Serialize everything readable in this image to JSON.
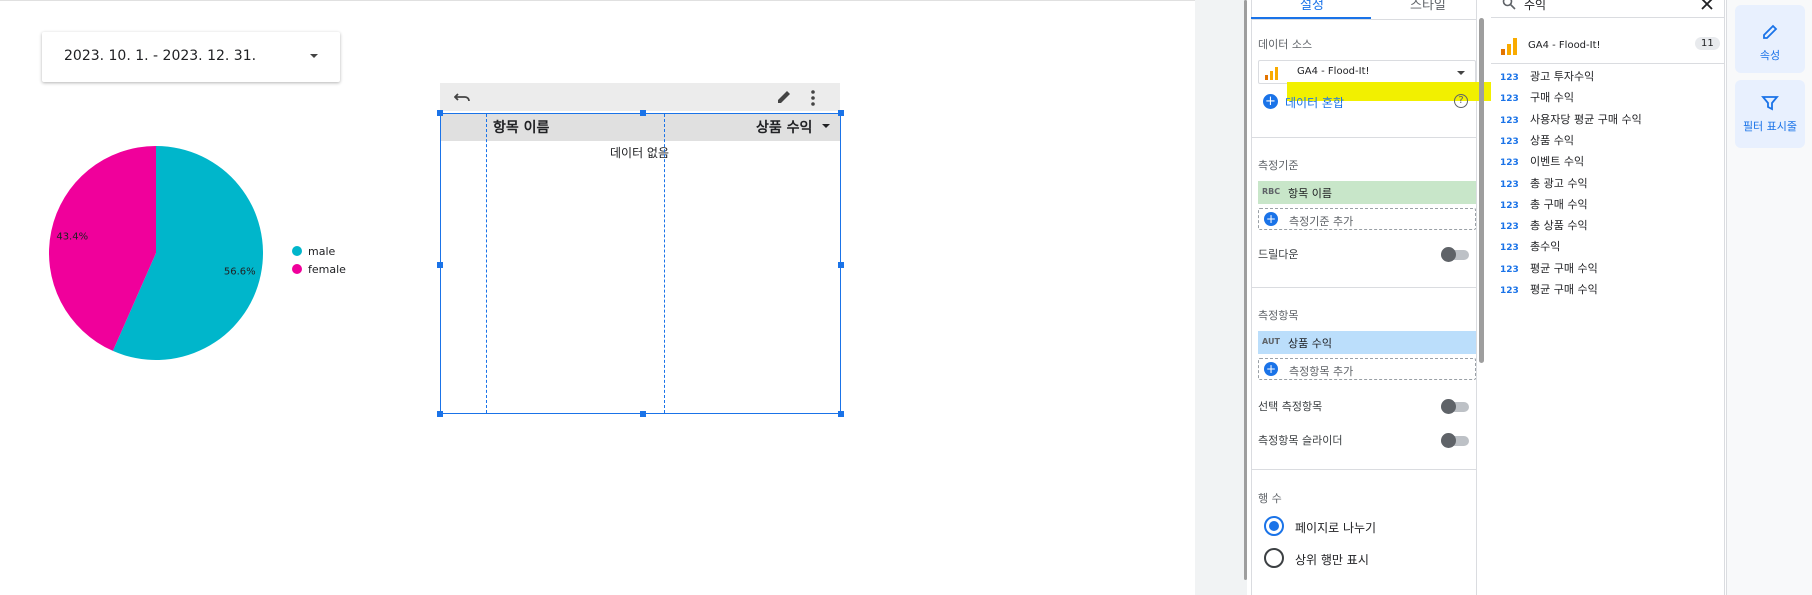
{
  "date_control": {
    "value": "2023. 10. 1. - 2023. 12. 31."
  },
  "pie_chart": {
    "slices": [
      {
        "name": "male",
        "percent": 56.6,
        "label": "56.6%",
        "color": "#00b6cb"
      },
      {
        "name": "female",
        "percent": 43.4,
        "label": "43.4%",
        "color": "#f0009b"
      }
    ],
    "legend": [
      "male",
      "female"
    ]
  },
  "table_chart": {
    "columns": [
      "항목 이름",
      "상품 수익"
    ],
    "empty_message": "데이터 없음"
  },
  "properties": {
    "tabs": [
      "설정",
      "스타일"
    ],
    "data_source_label": "데이터 소스",
    "data_source_value": "GA4 - Flood-It!",
    "blend_label": "데이터 혼합",
    "dimension_label": "측정기준",
    "dimension_type": "RBC",
    "dimension_value": "항목 이름",
    "add_dimension": "측정기준 추가",
    "drilldown_label": "드릴다운",
    "metric_label": "측정항목",
    "metric_type": "AUT",
    "metric_value": "상품 수익",
    "add_metric": "측정항목 추가",
    "optional_metric_label": "선택 측정항목",
    "metric_slider_label": "측정항목 슬라이더",
    "rows_label": "행 수",
    "paginate_label": "페이지로 나누기",
    "top_rows_label": "상위 행만 표시"
  },
  "field_list": {
    "search_value": "수익",
    "source_name": "GA4 - Flood-It!",
    "source_count": "11",
    "type_label": "123",
    "fields": [
      "광고 투자수익",
      "구매 수익",
      "사용자당 평균 구매 수익",
      "상품 수익",
      "이벤트 수익",
      "총 광고 수익",
      "총 구매 수익",
      "총 상품 수익",
      "총수익",
      "평균 구매 수익",
      "평균 구매 수익"
    ]
  },
  "rail": {
    "properties_label": "속성",
    "filter_label": "필터 표시줄"
  },
  "colors": {
    "accent": "#1a73e8",
    "male": "#00b6cb",
    "female": "#f0009b",
    "highlight": "#f2f000"
  }
}
